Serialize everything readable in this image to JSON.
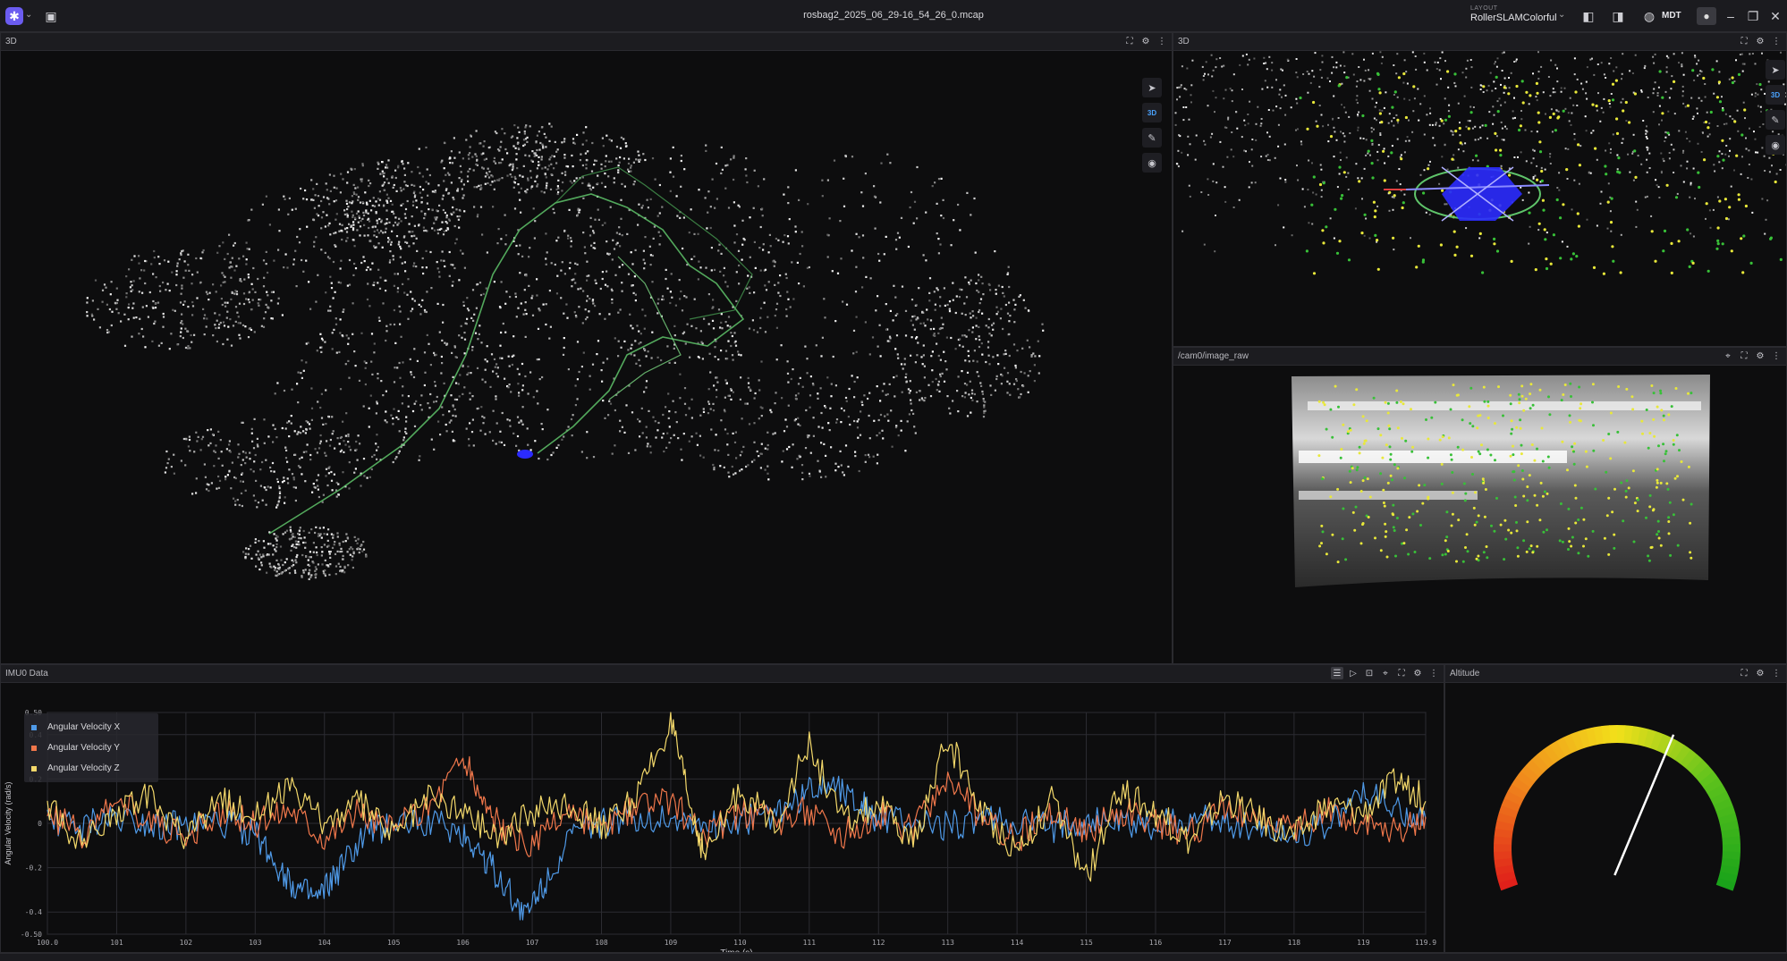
{
  "app": {
    "logo_icon": "app-logo-icon",
    "file_name": "rosbag2_2025_06_29-16_54_26_0.mcap",
    "layout_caption": "LAYOUT",
    "layout_name": "RollerSLAMColorful",
    "timezone": "MDT"
  },
  "panels": {
    "main3d": {
      "title": "3D",
      "view_mode": "3D"
    },
    "top3d": {
      "title": "3D",
      "view_mode": "3D"
    },
    "camera": {
      "title": "/cam0/image_raw"
    },
    "imu": {
      "title": "IMU0 Data"
    },
    "altitude": {
      "title": "Altitude"
    }
  },
  "colors": {
    "series_x": "#4f9ae8",
    "series_y": "#f0774b",
    "series_z": "#f3d86a",
    "trajectory": "#5fc46a",
    "robot": "#2b2bff",
    "feature_yellow": "#e8e83a",
    "feature_green": "#38c038"
  },
  "chart_data": {
    "type": "line",
    "title": "",
    "xlabel": "Time (s)",
    "ylabel": "Angular Velocity (rad/s)",
    "xlim": [
      100.0,
      119.9
    ],
    "ylim": [
      -0.5,
      0.5
    ],
    "x_ticks": [
      "100.0",
      "101",
      "102",
      "103",
      "104",
      "105",
      "106",
      "107",
      "108",
      "109",
      "110",
      "111",
      "112",
      "113",
      "114",
      "115",
      "116",
      "117",
      "118",
      "119",
      "119.9"
    ],
    "y_ticks": [
      "0.50",
      "0.4",
      "0.2",
      "0",
      "-0.2",
      "-0.4",
      "-0.50"
    ],
    "grid": true,
    "legend": "top-left",
    "series": [
      {
        "name": "Angular Velocity X",
        "color": "#4f9ae8",
        "x": [
          100.0,
          100.5,
          101.0,
          101.5,
          102.0,
          102.5,
          103.0,
          103.3,
          103.6,
          103.9,
          104.2,
          104.6,
          105.0,
          105.5,
          106.0,
          106.3,
          106.6,
          106.9,
          107.2,
          107.6,
          108.0,
          108.5,
          109.0,
          109.5,
          110.0,
          110.5,
          110.9,
          111.3,
          111.7,
          112.0,
          112.5,
          113.0,
          113.5,
          114.0,
          114.5,
          115.0,
          115.5,
          116.0,
          116.5,
          117.0,
          117.5,
          118.0,
          118.5,
          119.0,
          119.5,
          119.9
        ],
        "y": [
          0.02,
          -0.01,
          0.03,
          0.0,
          -0.02,
          0.01,
          -0.05,
          -0.18,
          -0.3,
          -0.35,
          -0.22,
          -0.05,
          0.0,
          0.01,
          -0.05,
          -0.15,
          -0.28,
          -0.42,
          -0.25,
          -0.05,
          0.0,
          0.02,
          0.03,
          -0.01,
          0.01,
          0.04,
          0.12,
          0.2,
          0.1,
          0.02,
          0.0,
          -0.01,
          0.02,
          0.0,
          -0.02,
          0.01,
          0.0,
          -0.01,
          0.02,
          0.01,
          -0.02,
          -0.05,
          0.0,
          0.15,
          0.05,
          0.02
        ]
      },
      {
        "name": "Angular Velocity Y",
        "color": "#f0774b",
        "x": [
          100.0,
          100.5,
          101.0,
          101.5,
          102.0,
          102.5,
          103.0,
          103.5,
          104.0,
          104.5,
          105.0,
          105.5,
          106.0,
          106.3,
          106.6,
          107.0,
          107.5,
          108.0,
          108.5,
          109.0,
          109.5,
          110.0,
          110.5,
          111.0,
          111.5,
          112.0,
          112.5,
          113.0,
          113.5,
          114.0,
          114.5,
          115.0,
          115.5,
          116.0,
          116.5,
          117.0,
          117.5,
          118.0,
          118.5,
          119.0,
          119.5,
          119.9
        ],
        "y": [
          0.05,
          -0.05,
          0.08,
          0.02,
          -0.08,
          0.05,
          0.0,
          0.08,
          -0.05,
          0.06,
          -0.03,
          0.08,
          0.3,
          0.1,
          -0.05,
          -0.1,
          0.05,
          -0.04,
          0.07,
          0.1,
          -0.06,
          0.05,
          0.0,
          0.06,
          -0.05,
          0.04,
          -0.03,
          0.2,
          0.02,
          -0.07,
          0.05,
          -0.04,
          0.06,
          0.0,
          -0.05,
          0.07,
          0.02,
          -0.03,
          0.05,
          0.0,
          -0.04,
          0.03
        ]
      },
      {
        "name": "Angular Velocity Z",
        "color": "#f3d86a",
        "x": [
          100.0,
          100.5,
          101.0,
          101.5,
          102.0,
          102.5,
          103.0,
          103.5,
          104.0,
          104.5,
          105.0,
          105.5,
          106.0,
          106.5,
          107.0,
          107.5,
          108.0,
          108.5,
          109.0,
          109.3,
          109.5,
          110.0,
          110.5,
          111.0,
          111.5,
          112.0,
          112.5,
          113.0,
          113.5,
          114.0,
          114.5,
          115.0,
          115.5,
          116.0,
          116.5,
          117.0,
          117.5,
          118.0,
          118.5,
          119.0,
          119.5,
          119.9
        ],
        "y": [
          0.08,
          -0.1,
          0.06,
          0.12,
          -0.08,
          0.1,
          0.05,
          0.15,
          0.0,
          0.1,
          -0.05,
          0.12,
          0.06,
          -0.05,
          0.04,
          0.1,
          -0.02,
          0.12,
          0.45,
          0.05,
          -0.15,
          0.15,
          0.0,
          0.35,
          0.0,
          0.08,
          -0.1,
          0.38,
          0.05,
          -0.12,
          0.1,
          -0.25,
          0.15,
          0.05,
          -0.08,
          0.12,
          0.02,
          -0.06,
          0.08,
          0.05,
          0.2,
          0.1
        ]
      }
    ]
  },
  "gauge": {
    "needle_fraction": 0.62,
    "colors": [
      "#e0201a",
      "#f08a1c",
      "#f2e01a",
      "#5cc21c",
      "#1aa31a"
    ]
  }
}
